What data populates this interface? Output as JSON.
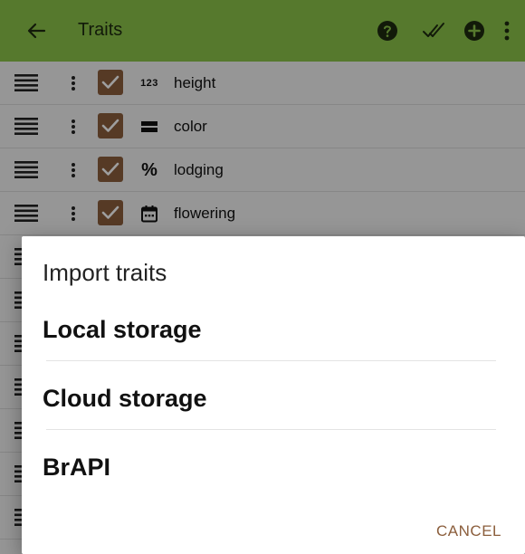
{
  "colors": {
    "toolbar_bg": "#8BC34A",
    "accent_brown": "#8B5E3C",
    "scrim": "rgba(0,0,0,0.38)"
  },
  "toolbar": {
    "title": "Traits",
    "icons": [
      "back-arrow-icon",
      "help-icon",
      "double-check-icon",
      "add-circle-icon",
      "overflow-menu-icon"
    ]
  },
  "traits": [
    {
      "type_icon": "numeric-icon",
      "type_glyph": "123",
      "name": "height",
      "checked": true
    },
    {
      "type_icon": "categorical-icon",
      "type_glyph": "",
      "name": "color",
      "checked": true
    },
    {
      "type_icon": "percent-icon",
      "type_glyph": "%",
      "name": "lodging",
      "checked": true
    },
    {
      "type_icon": "date-icon",
      "type_glyph": "",
      "name": "flowering",
      "checked": true
    }
  ],
  "dialog": {
    "title": "Import traits",
    "options": [
      "Local storage",
      "Cloud storage",
      "BrAPI"
    ],
    "cancel_label": "CANCEL"
  }
}
